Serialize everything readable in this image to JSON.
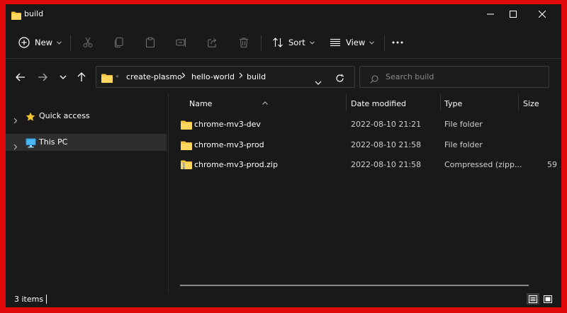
{
  "window": {
    "title": "build"
  },
  "toolbar": {
    "new_label": "New",
    "sort_label": "Sort",
    "view_label": "View"
  },
  "address": {
    "overflow_glyph": "«",
    "crumbs": [
      "create-plasmo",
      "hello-world",
      "build"
    ]
  },
  "search": {
    "placeholder": "Search build"
  },
  "navpane": {
    "items": [
      {
        "label": "Quick access",
        "icon": "star-icon"
      },
      {
        "label": "This PC",
        "icon": "monitor-icon",
        "selected": true
      }
    ]
  },
  "columns": {
    "name": "Name",
    "date": "Date modified",
    "type": "Type",
    "size": "Size"
  },
  "files": [
    {
      "name": "chrome-mv3-dev",
      "date": "2022-08-10 21:21",
      "type": "File folder",
      "size": "",
      "icon": "folder-icon"
    },
    {
      "name": "chrome-mv3-prod",
      "date": "2022-08-10 21:58",
      "type": "File folder",
      "size": "",
      "icon": "folder-icon"
    },
    {
      "name": "chrome-mv3-prod.zip",
      "date": "2022-08-10 21:58",
      "type": "Compressed (zipp...",
      "size": "59",
      "icon": "zip-folder-icon"
    }
  ],
  "status": {
    "item_count": "3 items"
  },
  "colors": {
    "frame": "#e00a0a",
    "background": "#191919",
    "folder": "#f4c542",
    "selected": "#2e2e2e"
  }
}
